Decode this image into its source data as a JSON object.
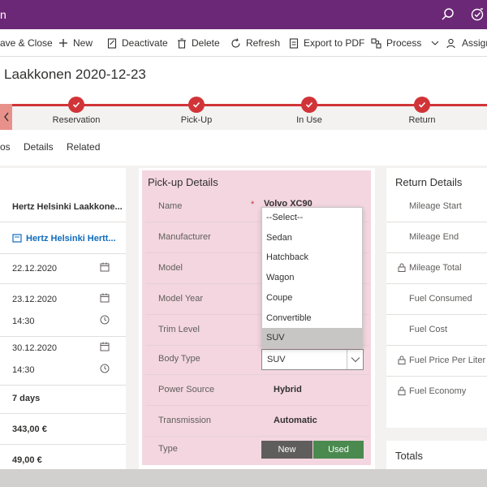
{
  "appbar": {
    "title": "n",
    "icons": [
      "search-icon",
      "assistant-icon"
    ]
  },
  "commands": [
    {
      "label": "ave & Close",
      "icon": "save-icon"
    },
    {
      "label": "New",
      "icon": "plus-icon"
    },
    {
      "label": "Deactivate",
      "icon": "deactivate-icon"
    },
    {
      "label": "Delete",
      "icon": "trash-icon"
    },
    {
      "label": "Refresh",
      "icon": "refresh-icon"
    },
    {
      "label": "Export to PDF",
      "icon": "pdf-icon"
    },
    {
      "label": "Process",
      "icon": "process-icon"
    },
    {
      "label": "Assign",
      "icon": "assign-icon"
    }
  ],
  "record": {
    "title": "Laakkonen 2020-12-23"
  },
  "bpf": {
    "stages": [
      "Reservation",
      "Pick-Up",
      "In Use",
      "Return"
    ]
  },
  "tabs": [
    "os",
    "Details",
    "Related"
  ],
  "left_column": {
    "rows": [
      {
        "value": "Hertz Helsinki Laakkone...",
        "style": "bold"
      },
      {
        "value": "Hertz Helsinki Hertt...",
        "style": "link"
      },
      {
        "value": "22.12.2020",
        "style": "date"
      },
      {
        "value": "23.12.2020",
        "style": "date"
      },
      {
        "value": "14:30",
        "style": "time"
      },
      {
        "value": "30.12.2020",
        "style": "date"
      },
      {
        "value": "14:30",
        "style": "time"
      },
      {
        "value": "7 days",
        "style": "bold"
      },
      {
        "value": "343,00 €",
        "style": "bold"
      },
      {
        "value": "49,00 €",
        "style": "bold"
      }
    ]
  },
  "pickup": {
    "title": "Pick-up Details",
    "fields": [
      {
        "label": "Name",
        "value": "Volvo XC90",
        "required": "*"
      },
      {
        "label": "Manufacturer",
        "value": ""
      },
      {
        "label": "Model",
        "value": ""
      },
      {
        "label": "Model Year",
        "value": ""
      },
      {
        "label": "Trim Level",
        "value": ""
      },
      {
        "label": "Body Type",
        "value": ""
      },
      {
        "label": "Power Source",
        "value": "Hybrid"
      },
      {
        "label": "Transmission",
        "value": "Automatic"
      },
      {
        "label": "Type",
        "value": ""
      }
    ],
    "body_type_select": {
      "value": "SUV",
      "options": [
        "--Select--",
        "Sedan",
        "Hatchback",
        "Wagon",
        "Coupe",
        "Convertible",
        "SUV"
      ],
      "highlighted": "SUV"
    },
    "type_toggle": {
      "new_label": "New",
      "used_label": "Used",
      "selected": "Used"
    }
  },
  "return": {
    "title": "Return Details",
    "fields": [
      {
        "label": "Mileage Start",
        "locked": false
      },
      {
        "label": "Mileage End",
        "locked": false
      },
      {
        "label": "Mileage Total",
        "locked": true
      },
      {
        "label": "Fuel Consumed",
        "locked": false
      },
      {
        "label": "Fuel Cost",
        "locked": false
      },
      {
        "label": "Fuel Price Per Liter",
        "locked": true
      },
      {
        "label": "Fuel Economy",
        "locked": true
      }
    ]
  },
  "totals": {
    "title": "Totals"
  },
  "colors": {
    "appbar": "#6b2876",
    "bpf_active": "#d13438",
    "pickup_bg": "#f3d6e0",
    "toggle_new": "#605e5c",
    "toggle_used": "#4a8a4f",
    "link": "#0f6cbd"
  }
}
